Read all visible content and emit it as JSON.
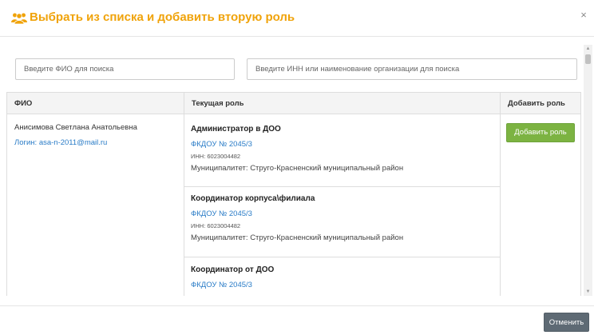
{
  "modal": {
    "title": "Выбрать из списка и добавить вторую роль",
    "title_icon": "users-icon",
    "close_label": "×",
    "accent_color": "#f0a30a"
  },
  "search": {
    "fio_placeholder": "Введите ФИО для поиска",
    "fio_value": "",
    "org_placeholder": "Введите ИНН или наименование организации для поиска",
    "org_value": ""
  },
  "table": {
    "headers": {
      "fio": "ФИО",
      "role": "Текущая роль",
      "add": "Добавить роль"
    },
    "rows": [
      {
        "name": "Анисимова Светлана Анатольевна",
        "login": "Логин: asa-n-2011@mail.ru",
        "add_button": "Добавить роль",
        "roles": [
          {
            "title": "Администратор в ДОО",
            "org": "ФКДОУ № 2045/3",
            "inn": "ИНН: 6023004482",
            "municipality": "Муниципалитет: Стругo-Красненский муниципальный район"
          },
          {
            "title": "Координатор корпуса\\филиала",
            "org": "ФКДОУ № 2045/3",
            "inn": "ИНН: 6023004482",
            "municipality": "Муниципалитет: Стругo-Красненский муниципальный район"
          },
          {
            "title": "Координатор от ДОО",
            "org": "ФКДОУ № 2045/3"
          }
        ]
      }
    ]
  },
  "footer": {
    "cancel_label": "Отменить"
  },
  "colors": {
    "add_button": "#7cb342",
    "cancel_button": "#5e6a74",
    "link": "#2a7cc7"
  }
}
